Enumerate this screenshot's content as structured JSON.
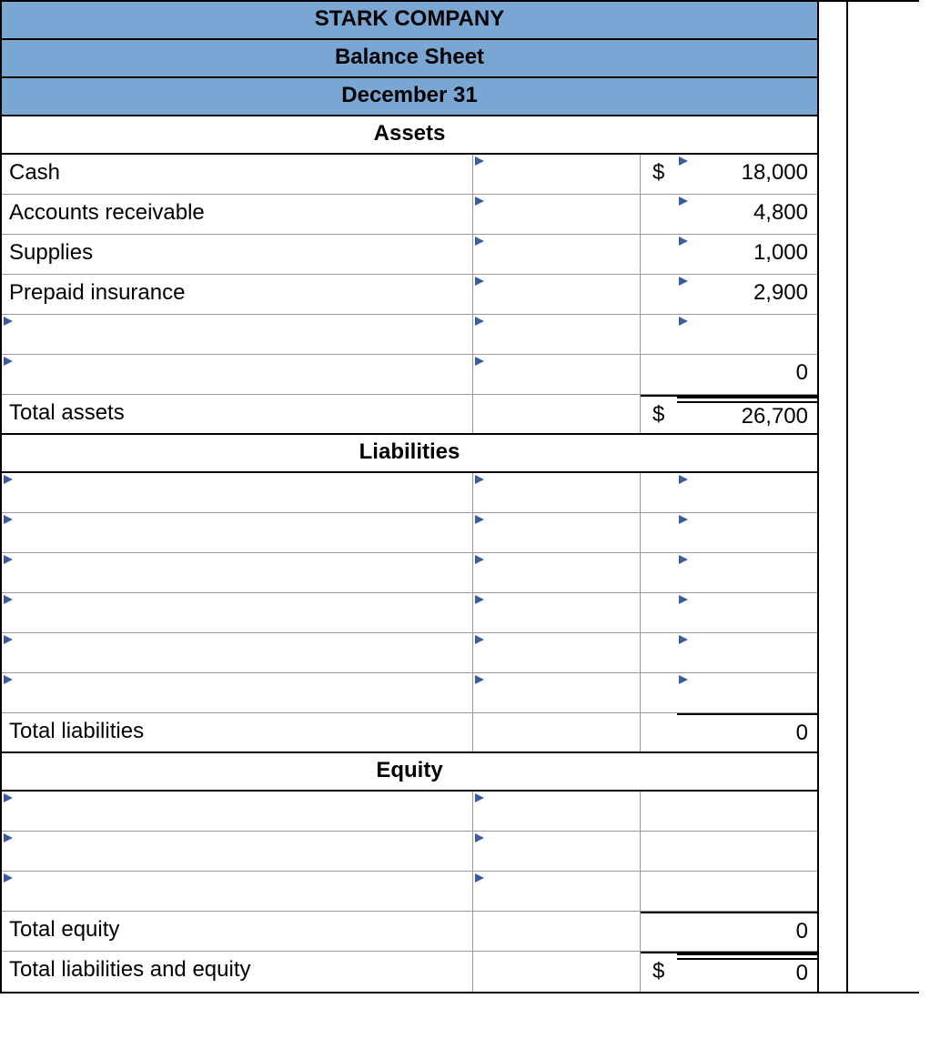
{
  "header": {
    "company": "STARK COMPANY",
    "title": "Balance Sheet",
    "date": "December 31"
  },
  "sections": {
    "assets": {
      "label": "Assets",
      "rows": [
        {
          "label": "Cash",
          "mid_tri": true,
          "sym": "$",
          "val": "18,000",
          "val_tri": true
        },
        {
          "label": "Accounts receivable",
          "mid_tri": true,
          "sym": "",
          "val": "4,800",
          "val_tri": true
        },
        {
          "label": "Supplies",
          "mid_tri": true,
          "sym": "",
          "val": "1,000",
          "val_tri": true
        },
        {
          "label": "Prepaid insurance",
          "mid_tri": true,
          "sym": "",
          "val": "2,900",
          "val_tri": true
        },
        {
          "label": "",
          "label_tri": true,
          "mid_tri": true,
          "sym": "",
          "val": "",
          "val_tri": true
        },
        {
          "label": "",
          "label_tri": true,
          "mid_tri": true,
          "sym": "",
          "val": "0",
          "val_tri": false
        }
      ],
      "total": {
        "label": "Total assets",
        "sym": "$",
        "val": "26,700"
      }
    },
    "liabilities": {
      "label": "Liabilities",
      "rows": [
        {
          "label": "",
          "label_tri": true,
          "mid_tri": true,
          "sym": "",
          "val": "",
          "val_tri": true
        },
        {
          "label": "",
          "label_tri": true,
          "mid_tri": true,
          "sym": "",
          "val": "",
          "val_tri": true
        },
        {
          "label": "",
          "label_tri": true,
          "mid_tri": true,
          "sym": "",
          "val": "",
          "val_tri": true
        },
        {
          "label": "",
          "label_tri": true,
          "mid_tri": true,
          "sym": "",
          "val": "",
          "val_tri": true
        },
        {
          "label": "",
          "label_tri": true,
          "mid_tri": true,
          "sym": "",
          "val": "",
          "val_tri": true
        },
        {
          "label": "",
          "label_tri": true,
          "mid_tri": true,
          "sym": "",
          "val": "",
          "val_tri": true
        }
      ],
      "total": {
        "label": "Total liabilities",
        "sym": "",
        "val": "0"
      }
    },
    "equity": {
      "label": "Equity",
      "rows": [
        {
          "label": "",
          "label_tri": true,
          "mid_tri": true,
          "sym": "",
          "val": "",
          "val_tri": false
        },
        {
          "label": "",
          "label_tri": true,
          "mid_tri": true,
          "sym": "",
          "val": "",
          "val_tri": false
        },
        {
          "label": "",
          "label_tri": true,
          "mid_tri": true,
          "sym": "",
          "val": "",
          "val_tri": false
        }
      ],
      "total_equity": {
        "label": "Total equity",
        "sym": "",
        "val": "0"
      },
      "total_le": {
        "label": "Total liabilities and equity",
        "sym": "$",
        "val": "0"
      }
    }
  }
}
